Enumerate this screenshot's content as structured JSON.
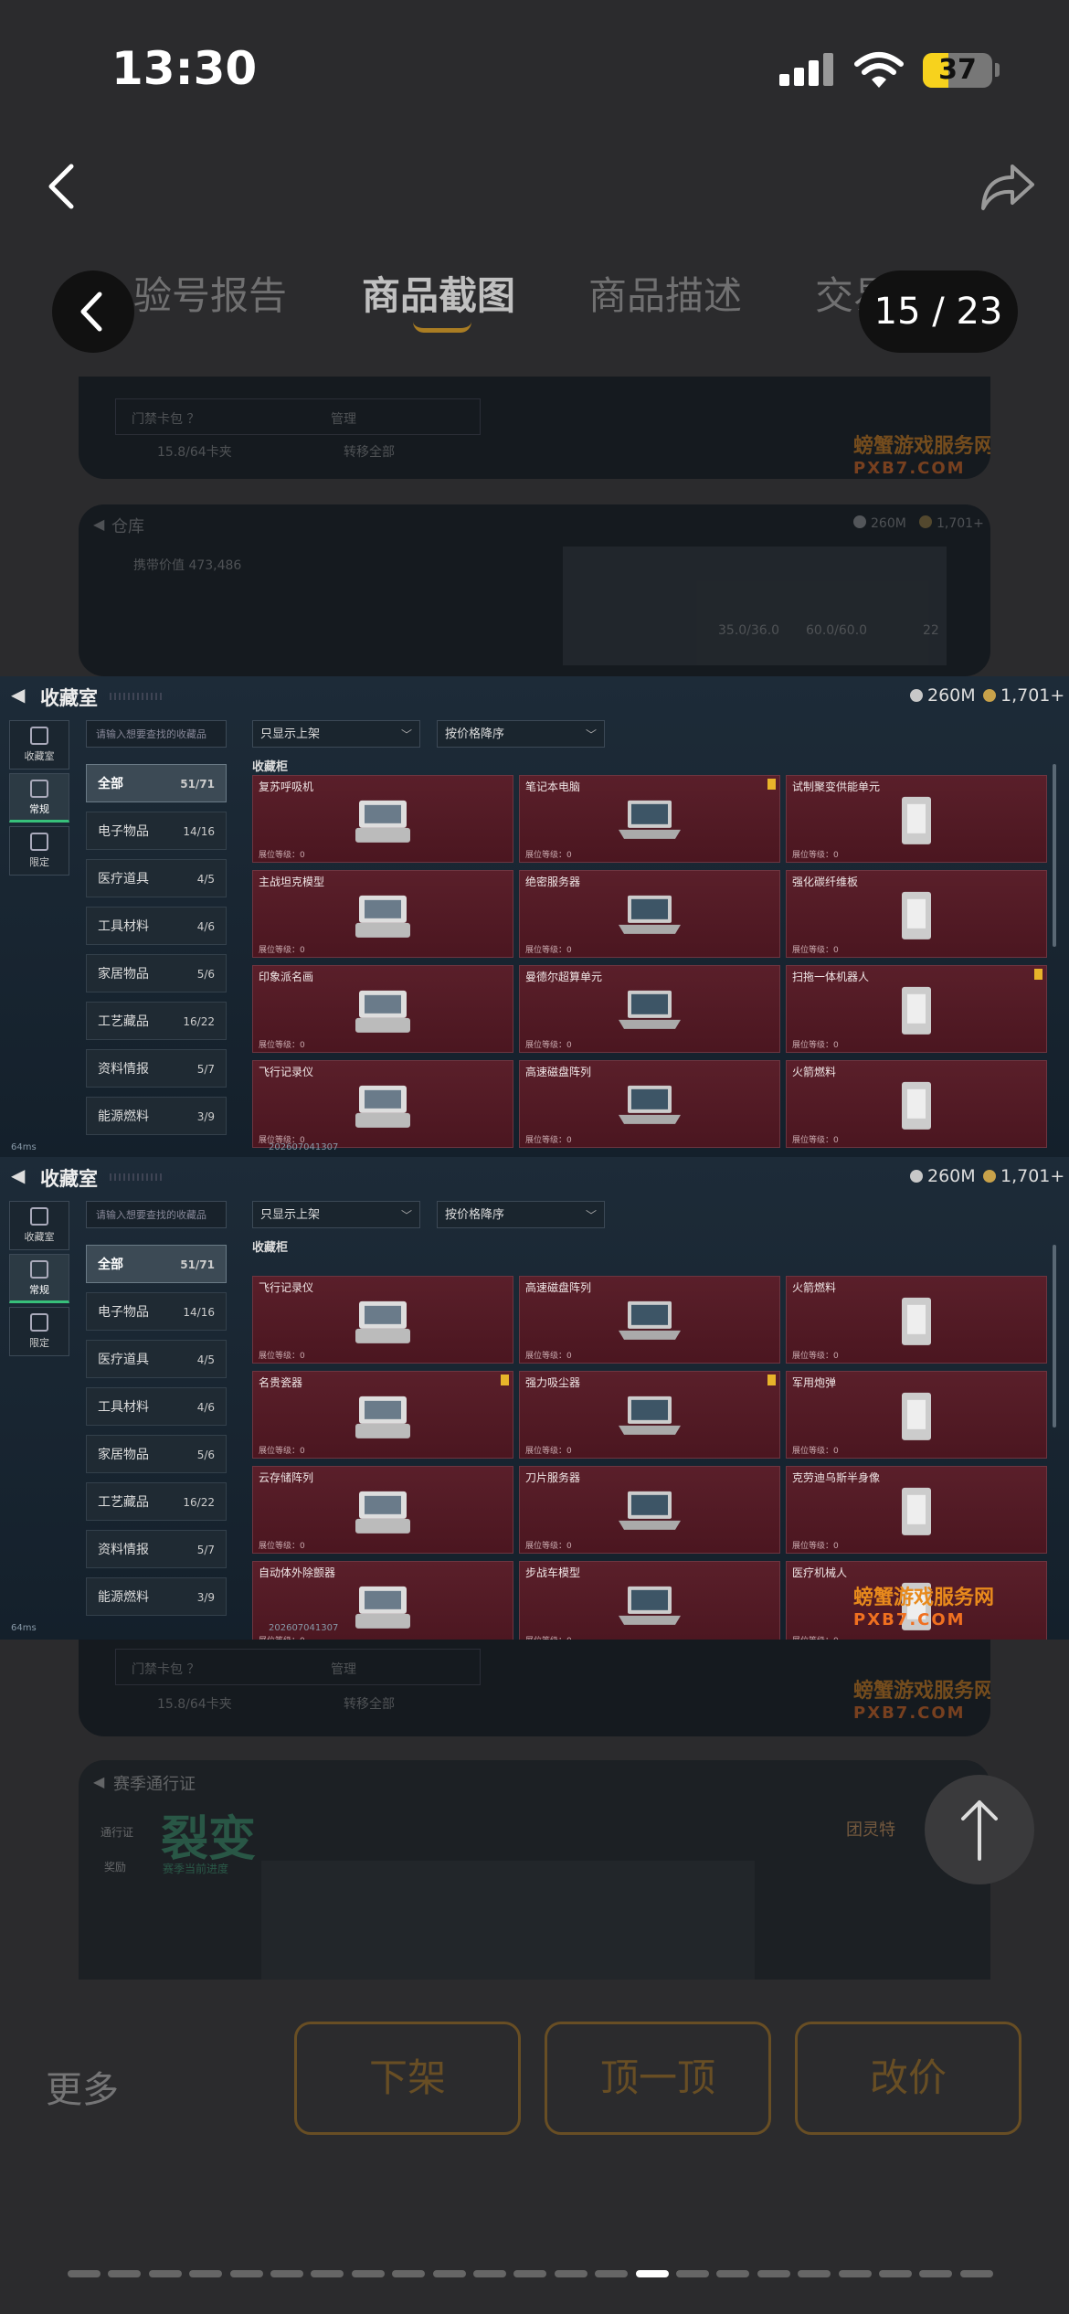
{
  "status": {
    "time": "13:30",
    "battery": "37",
    "battery_level": 0.37
  },
  "tabs": [
    {
      "label": "验号报告",
      "active": false
    },
    {
      "label": "商品截图",
      "active": true
    },
    {
      "label": "商品描述",
      "active": false
    },
    {
      "label": "交易",
      "active": false
    }
  ],
  "counter": "15 / 23",
  "dim_top": {
    "field1": "门禁卡包 ？",
    "btn1": "管理",
    "size": "15.8/64卡夹",
    "btn2": "转移全部",
    "wm_cn": "螃蟹游戏服务网",
    "wm_en": "PXB7.COM"
  },
  "dim_warehouse": {
    "title": "仓库",
    "silver": "260M",
    "gold": "1,701+",
    "value": "携带价值 473,486",
    "stat1": "35.0/36.0",
    "stat2": "60.0/60.0",
    "stat3": "22"
  },
  "game": {
    "title": "收藏室",
    "silver": "260M",
    "gold": "1,701+",
    "side_tabs": [
      "收藏室",
      "常规",
      "限定"
    ],
    "search_placeholder": "请输入想要查找的收藏品",
    "filter": "只显示上架",
    "sort": "按价格降序",
    "section": "收藏柜",
    "categories": [
      {
        "label": "全部",
        "count": "51/71"
      },
      {
        "label": "电子物品",
        "count": "14/16"
      },
      {
        "label": "医疗道具",
        "count": "4/5"
      },
      {
        "label": "工具材料",
        "count": "4/6"
      },
      {
        "label": "家居物品",
        "count": "5/6"
      },
      {
        "label": "工艺藏品",
        "count": "16/22"
      },
      {
        "label": "资料情报",
        "count": "5/7"
      },
      {
        "label": "能源燃料",
        "count": "3/9"
      }
    ],
    "level_label": "展位等级：0",
    "ping": "64ms",
    "uid": "202607041307"
  },
  "panel1_items": [
    {
      "name": "复苏呼吸机",
      "badge": false
    },
    {
      "name": "笔记本电脑",
      "badge": true
    },
    {
      "name": "试制聚变供能单元",
      "badge": false
    },
    {
      "name": "主战坦克模型",
      "badge": false
    },
    {
      "name": "绝密服务器",
      "badge": false
    },
    {
      "name": "强化碳纤维板",
      "badge": false
    },
    {
      "name": "印象派名画",
      "badge": false
    },
    {
      "name": "曼德尔超算单元",
      "badge": false
    },
    {
      "name": "扫拖一体机器人",
      "badge": true
    },
    {
      "name": "飞行记录仪",
      "badge": false
    },
    {
      "name": "高速磁盘阵列",
      "badge": false
    },
    {
      "name": "火箭燃料",
      "badge": false
    }
  ],
  "panel2_items": [
    {
      "name": "飞行记录仪",
      "badge": false
    },
    {
      "name": "高速磁盘阵列",
      "badge": false
    },
    {
      "name": "火箭燃料",
      "badge": false
    },
    {
      "name": "名贵瓷器",
      "badge": true
    },
    {
      "name": "强力吸尘器",
      "badge": true
    },
    {
      "name": "军用炮弹",
      "badge": false
    },
    {
      "name": "云存储阵列",
      "badge": false
    },
    {
      "name": "刀片服务器",
      "badge": false
    },
    {
      "name": "克劳迪乌斯半身像",
      "badge": false
    },
    {
      "name": "自动体外除颤器",
      "badge": false
    },
    {
      "name": "步战车模型",
      "badge": false
    },
    {
      "name": "医疗机械人",
      "badge": false
    }
  ],
  "watermark": {
    "cn": "螃蟹游戏服务网",
    "en": "PXB7.COM"
  },
  "season": {
    "title": "赛季通行证",
    "banner": "裂变",
    "sub": "赛季当前进度",
    "side1": "通行证",
    "side2": "奖励",
    "badge": "团灵特"
  },
  "bottom": {
    "more": "更多",
    "btn1": "下架",
    "btn2": "顶一顶",
    "btn3": "改价"
  },
  "pager": {
    "total": 23,
    "current": 15
  }
}
